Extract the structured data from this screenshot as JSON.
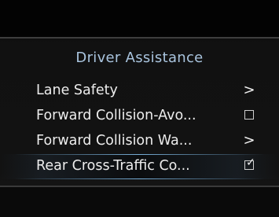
{
  "screen": {
    "title": "Driver Assistance",
    "items": [
      {
        "label": "Lane Safety",
        "control": "chevron",
        "glyph": ">",
        "checked": null,
        "selected": false
      },
      {
        "label": "Forward Collision-Avo...",
        "control": "checkbox",
        "glyph": "",
        "checked": false,
        "selected": false
      },
      {
        "label": "Forward Collision Wa...",
        "control": "chevron",
        "glyph": ">",
        "checked": null,
        "selected": false
      },
      {
        "label": "Rear Cross-Traffic Co...",
        "control": "checkbox",
        "glyph": "✓",
        "checked": true,
        "selected": true
      }
    ]
  },
  "colors": {
    "title": "#a9c4de",
    "text": "#ededed",
    "highlight": "#82bee8"
  },
  "icons": {
    "chevron": "chevron-right-icon",
    "checkbox_unchecked": "checkbox-unchecked-icon",
    "checkbox_checked": "checkbox-checked-icon"
  }
}
